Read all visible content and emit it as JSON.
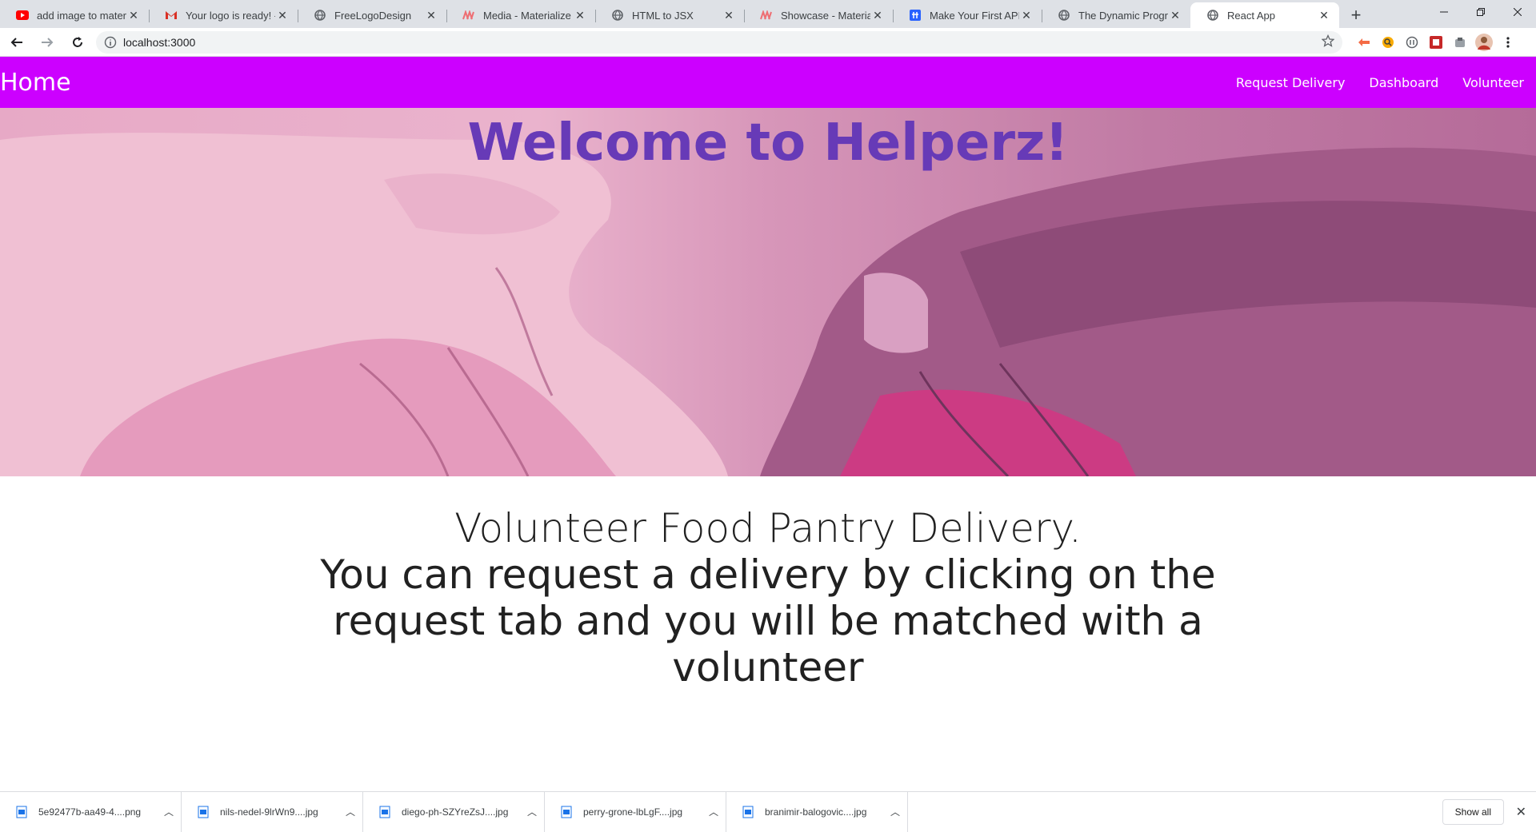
{
  "browser": {
    "tabs": [
      {
        "title": "add image to materializ",
        "icon": "youtube-icon"
      },
      {
        "title": "Your logo is ready! - dr",
        "icon": "gmail-icon"
      },
      {
        "title": "FreeLogoDesign",
        "icon": "globe-icon"
      },
      {
        "title": "Media - Materialize",
        "icon": "materialize-icon"
      },
      {
        "title": "HTML to JSX",
        "icon": "globe-icon"
      },
      {
        "title": "Showcase - Materialize",
        "icon": "materialize-icon"
      },
      {
        "title": "Make Your First API Cal",
        "icon": "hashnode-icon"
      },
      {
        "title": "The Dynamic Programm",
        "icon": "globe-icon"
      },
      {
        "title": "React App",
        "icon": "globe-icon",
        "active": true
      }
    ],
    "url": "localhost:3000"
  },
  "navbar": {
    "brand": "Home",
    "links": [
      "Request Delivery",
      "Dashboard",
      "Volunteer"
    ],
    "color": "#cc00ff"
  },
  "hero": {
    "title": "Welcome to Helperz!",
    "title_color": "#673ab7"
  },
  "content": {
    "heading": "Volunteer Food Pantry Delivery.",
    "text": "You can request a delivery by clicking on the request tab and you will be matched with a volunteer"
  },
  "downloads": {
    "items": [
      "5e92477b-aa49-4....png",
      "nils-nedel-9lrWn9....jpg",
      "diego-ph-SZYreZsJ....jpg",
      "perry-grone-lbLgF....jpg",
      "branimir-balogovic....jpg"
    ],
    "show_all": "Show all"
  }
}
